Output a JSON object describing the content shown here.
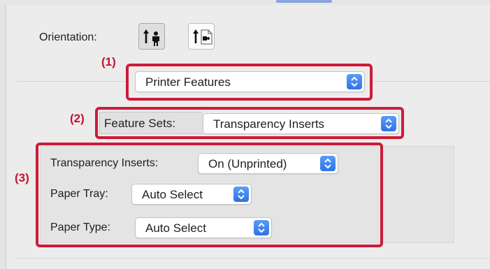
{
  "orientation": {
    "label": "Orientation:",
    "portrait_icon": "portrait-orientation-icon",
    "landscape_icon": "landscape-orientation-icon",
    "selected": "portrait"
  },
  "callouts": {
    "one": "(1)",
    "two": "(2)",
    "three": "(3)"
  },
  "section_menu": {
    "value": "Printer Features"
  },
  "feature_sets": {
    "label": "Feature Sets:",
    "value": "Transparency Inserts"
  },
  "options": [
    {
      "label": "Transparency Inserts:",
      "value": "On (Unprinted)"
    },
    {
      "label": "Paper Tray:",
      "value": "Auto Select"
    },
    {
      "label": "Paper Type:",
      "value": "Auto Select"
    }
  ],
  "colors": {
    "callout": "#cc1b3a",
    "accent": "#2f73e6"
  }
}
